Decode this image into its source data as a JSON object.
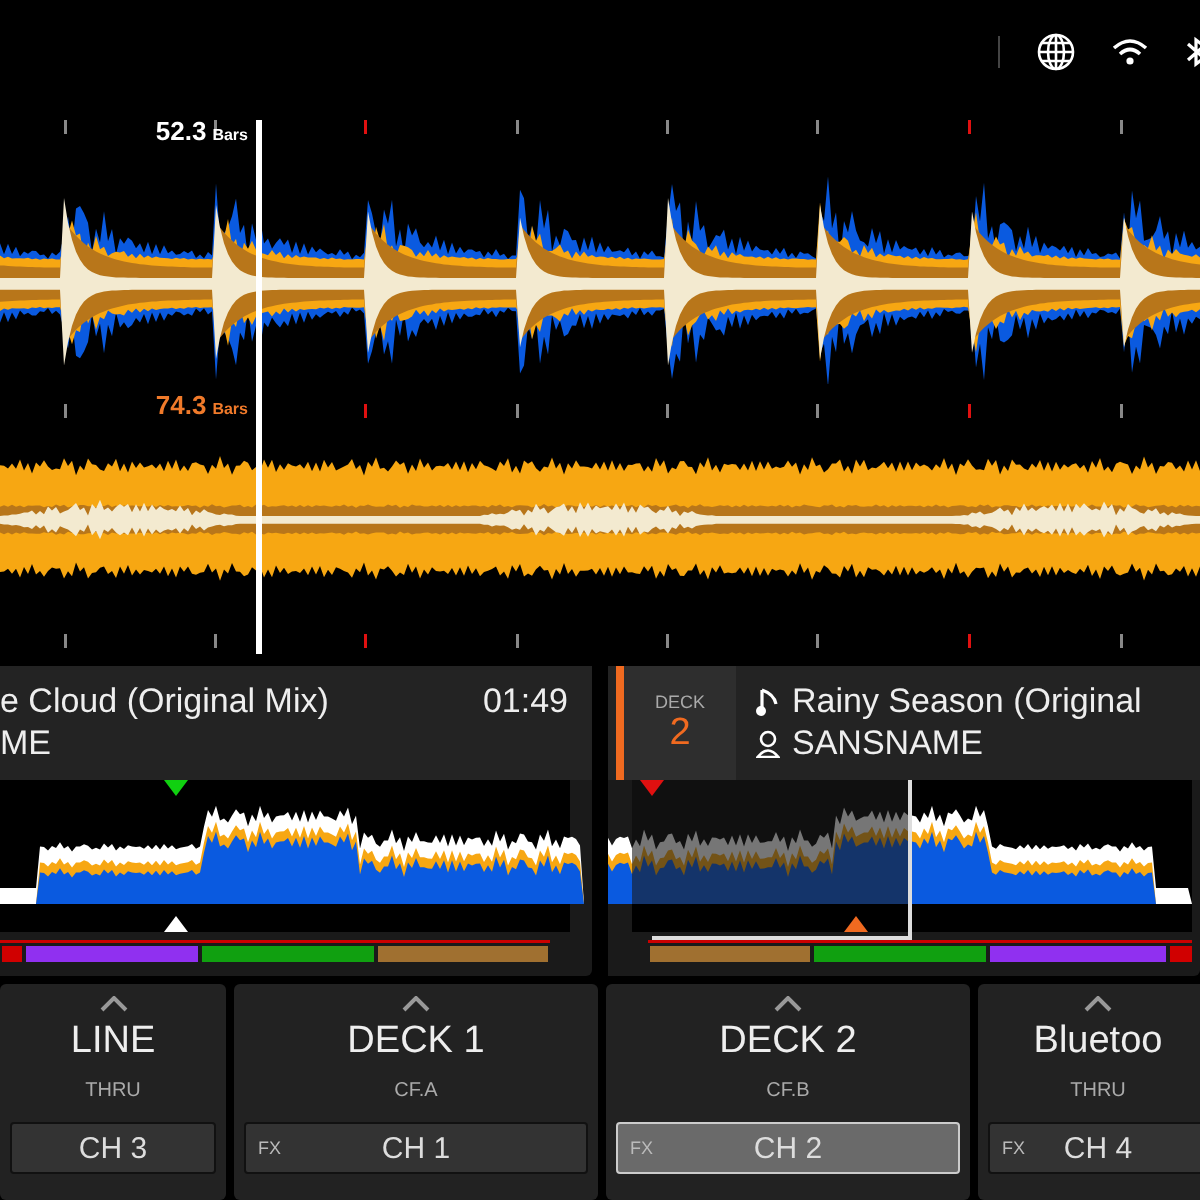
{
  "decks": [
    {
      "bars": "52.3",
      "unit": "Bars",
      "color": "#ffffff",
      "kind": "beats"
    },
    {
      "bars": "74.3",
      "unit": "Bars",
      "color": "#f07a2a",
      "kind": "smooth"
    }
  ],
  "track_panels": [
    {
      "title": "e Cloud (Original Mix)",
      "artist": "ME",
      "time": "01:49",
      "played": false
    },
    {
      "deck_label": "DECK",
      "deck_number": "2",
      "title": "Rainy Season (Original",
      "artist": "SANSNAME",
      "played": true
    }
  ],
  "channels": [
    {
      "name": "LINE",
      "mode": "THRU",
      "assign": "CH 3",
      "selected": false
    },
    {
      "name": "DECK 1",
      "mode": "CF.A",
      "fx": "FX",
      "assign": "CH 1",
      "selected": false
    },
    {
      "name": "DECK 2",
      "mode": "CF.B",
      "fx": "FX",
      "assign": "CH 2",
      "selected": true
    },
    {
      "name": "Bluetoo",
      "mode": "THRU",
      "fx": "FX",
      "assign": "CH 4",
      "selected": false
    }
  ]
}
